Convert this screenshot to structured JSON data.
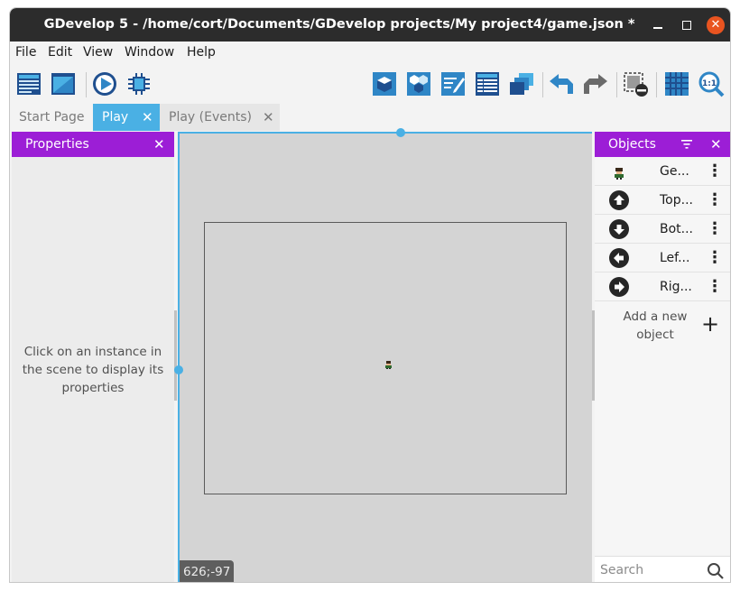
{
  "window": {
    "title": "GDevelop 5 - /home/cort/Documents/GDevelop projects/My project4/game.json *",
    "minimize_label": "–",
    "maximize_label": "",
    "close_label": "✕"
  },
  "menu": [
    "File",
    "Edit",
    "View",
    "Window",
    "Help"
  ],
  "toolbar": {
    "left_icons": [
      "project-manager-icon",
      "scene-icon",
      "preview-play-icon",
      "debugger-icon"
    ],
    "right_icons": [
      "objects-panel-icon",
      "object-groups-icon",
      "properties-edit-icon",
      "instances-list-icon",
      "layers-icon",
      "undo-icon",
      "redo-icon",
      "window-mask-icon",
      "grid-icon",
      "zoom-reset-icon"
    ],
    "zoom_reset_text": "1:1"
  },
  "tabs": [
    {
      "label": "Start Page",
      "active": false
    },
    {
      "label": "Play",
      "active": true,
      "close": "✕"
    },
    {
      "label": "Play (Events)",
      "active": false,
      "close": "✕"
    }
  ],
  "properties": {
    "title": "Properties",
    "close": "✕",
    "hint": "Click on an instance in the scene to display its properties"
  },
  "scene": {
    "coordinates": "626;-97"
  },
  "objects": {
    "title": "Objects",
    "close": "✕",
    "items": [
      {
        "name": "Ge...",
        "icon": "character-sprite-icon"
      },
      {
        "name": "Top...",
        "icon": "arrow-up-icon"
      },
      {
        "name": "Bot...",
        "icon": "arrow-down-icon"
      },
      {
        "name": "Lef...",
        "icon": "arrow-left-icon"
      },
      {
        "name": "Rig...",
        "icon": "arrow-right-icon"
      }
    ],
    "add_label": "Add a new object",
    "add_symbol": "+",
    "search_placeholder": "Search",
    "kebab": "⋮"
  },
  "colors": {
    "accent": "#4ab0e4",
    "panel_header": "#9c1ed6",
    "titlebar": "#2c2c2c",
    "close_button": "#e95420"
  }
}
